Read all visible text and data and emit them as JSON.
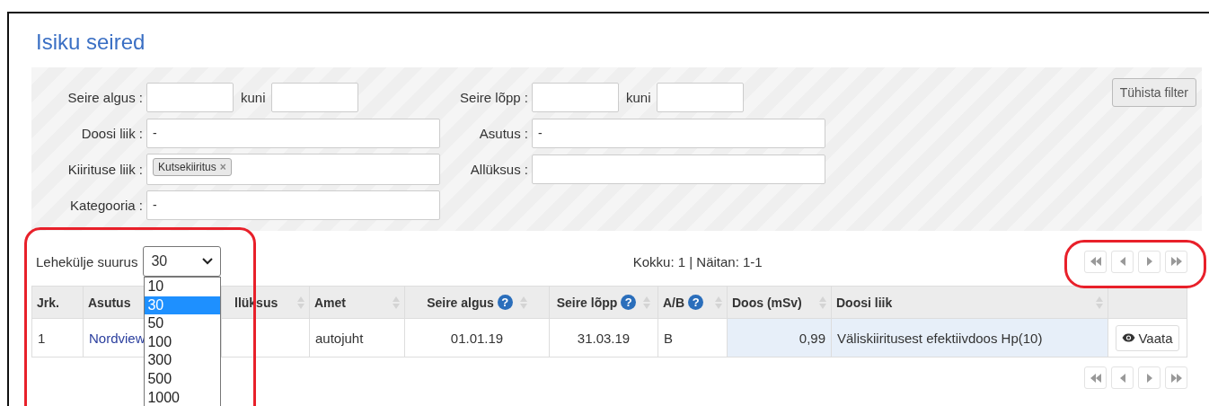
{
  "page": {
    "title": "Isiku seired"
  },
  "filter": {
    "rows": [
      [
        {
          "kind": "range",
          "label": "Seire algus :",
          "separator": "kuni"
        },
        {
          "kind": "range",
          "label": "Seire lõpp :",
          "separator": "kuni"
        }
      ],
      [
        {
          "kind": "select",
          "label": "Doosi liik :",
          "value": "-"
        },
        {
          "kind": "select",
          "label": "Asutus :",
          "value": "-"
        }
      ],
      [
        {
          "kind": "tags",
          "label": "Kiirituse liik :",
          "tags": [
            {
              "label": "Kutsekiiritus",
              "remove": "×"
            }
          ]
        },
        {
          "kind": "select",
          "label": "Allüksus :"
        }
      ],
      [
        {
          "kind": "select",
          "label": "Kategooria :",
          "value": "-"
        }
      ]
    ],
    "clear_button": "Tühista filter"
  },
  "page_size": {
    "label": "Lehekülje suurus",
    "value": "30",
    "expanded": true,
    "options": [
      {
        "label": "10",
        "selected": false
      },
      {
        "label": "30",
        "selected": true
      },
      {
        "label": "50",
        "selected": false
      },
      {
        "label": "100",
        "selected": false
      },
      {
        "label": "300",
        "selected": false
      },
      {
        "label": "500",
        "selected": false
      },
      {
        "label": "1000",
        "selected": false
      }
    ]
  },
  "summary": "Kokku: 1 | Näitan: 1-1",
  "table": {
    "columns": [
      {
        "label": "Jrk.",
        "sortable": false,
        "highlighted": false,
        "kind": "text"
      },
      {
        "label": "Asutus",
        "sortable": false,
        "highlighted": false,
        "kind": "link"
      },
      {
        "label": "llüksus",
        "sortable": true,
        "highlighted": false
      },
      {
        "label": "Amet",
        "sortable": true,
        "highlighted": false,
        "kind": "text"
      },
      {
        "label": "Seire algus",
        "help": "?",
        "sortable": true,
        "highlighted": false,
        "kind": "date"
      },
      {
        "label": "Seire lõpp",
        "help": "?",
        "sortable": true,
        "highlighted": false,
        "kind": "date"
      },
      {
        "label": "A/B",
        "help": "?",
        "sortable": true,
        "highlighted": false,
        "kind": "text"
      },
      {
        "label": "Doos (mSv)",
        "sortable": true,
        "highlighted": true,
        "kind": "number"
      },
      {
        "label": "Doosi liik",
        "sortable": true,
        "highlighted": true,
        "kind": "text"
      },
      {
        "sortable": false,
        "highlighted": false,
        "kind": "action"
      }
    ],
    "rows": [
      {
        "cells": [
          "1",
          "Nordview",
          null,
          "autojuht",
          "01.01.19",
          "31.03.19",
          "B",
          "0,99",
          "Väliskiiritusest efektiivdoos Hp(10)",
          "Vaata"
        ]
      }
    ]
  }
}
